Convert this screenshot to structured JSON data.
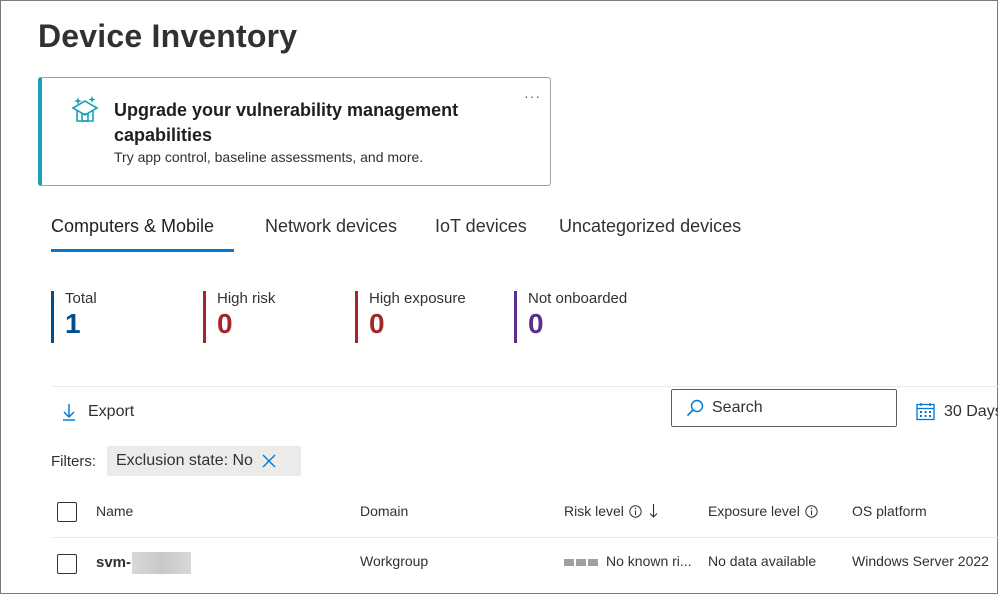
{
  "page_title": "Device Inventory",
  "banner": {
    "title": "Upgrade your vulnerability management capabilities",
    "subtitle": "Try app control, baseline assessments, and more.",
    "more": "···",
    "accent": "#1aa1b8"
  },
  "tabs": [
    {
      "label": "Computers & Mobile",
      "active": true
    },
    {
      "label": "Network devices",
      "active": false
    },
    {
      "label": "IoT devices",
      "active": false
    },
    {
      "label": "Uncategorized devices",
      "active": false
    }
  ],
  "stats": [
    {
      "label": "Total",
      "value": "1",
      "color": "#004e8c"
    },
    {
      "label": "High risk",
      "value": "0",
      "color": "#a4262c"
    },
    {
      "label": "High exposure",
      "value": "0",
      "color": "#a4262c"
    },
    {
      "label": "Not onboarded",
      "value": "0",
      "color": "#5c2e91"
    }
  ],
  "toolbar": {
    "export_label": "Export",
    "search_placeholder": "Search",
    "date_label": "30 Days"
  },
  "filters": {
    "label": "Filters:",
    "chips": [
      {
        "text": "Exclusion state: No"
      }
    ]
  },
  "table": {
    "columns": [
      "Name",
      "Domain",
      "Risk level",
      "Exposure level",
      "OS platform"
    ],
    "rows": [
      {
        "name_prefix": "svm-",
        "domain": "Workgroup",
        "risk": "No known ri...",
        "exposure": "No data available",
        "os": "Windows Server 2022"
      }
    ]
  },
  "icons": {
    "banner": "box-sparkle-icon",
    "export": "download-arrow-icon",
    "search": "search-icon",
    "date": "calendar-icon",
    "chip_close": "close-icon",
    "info": "info-icon",
    "sort": "sort-down-arrow-icon"
  }
}
